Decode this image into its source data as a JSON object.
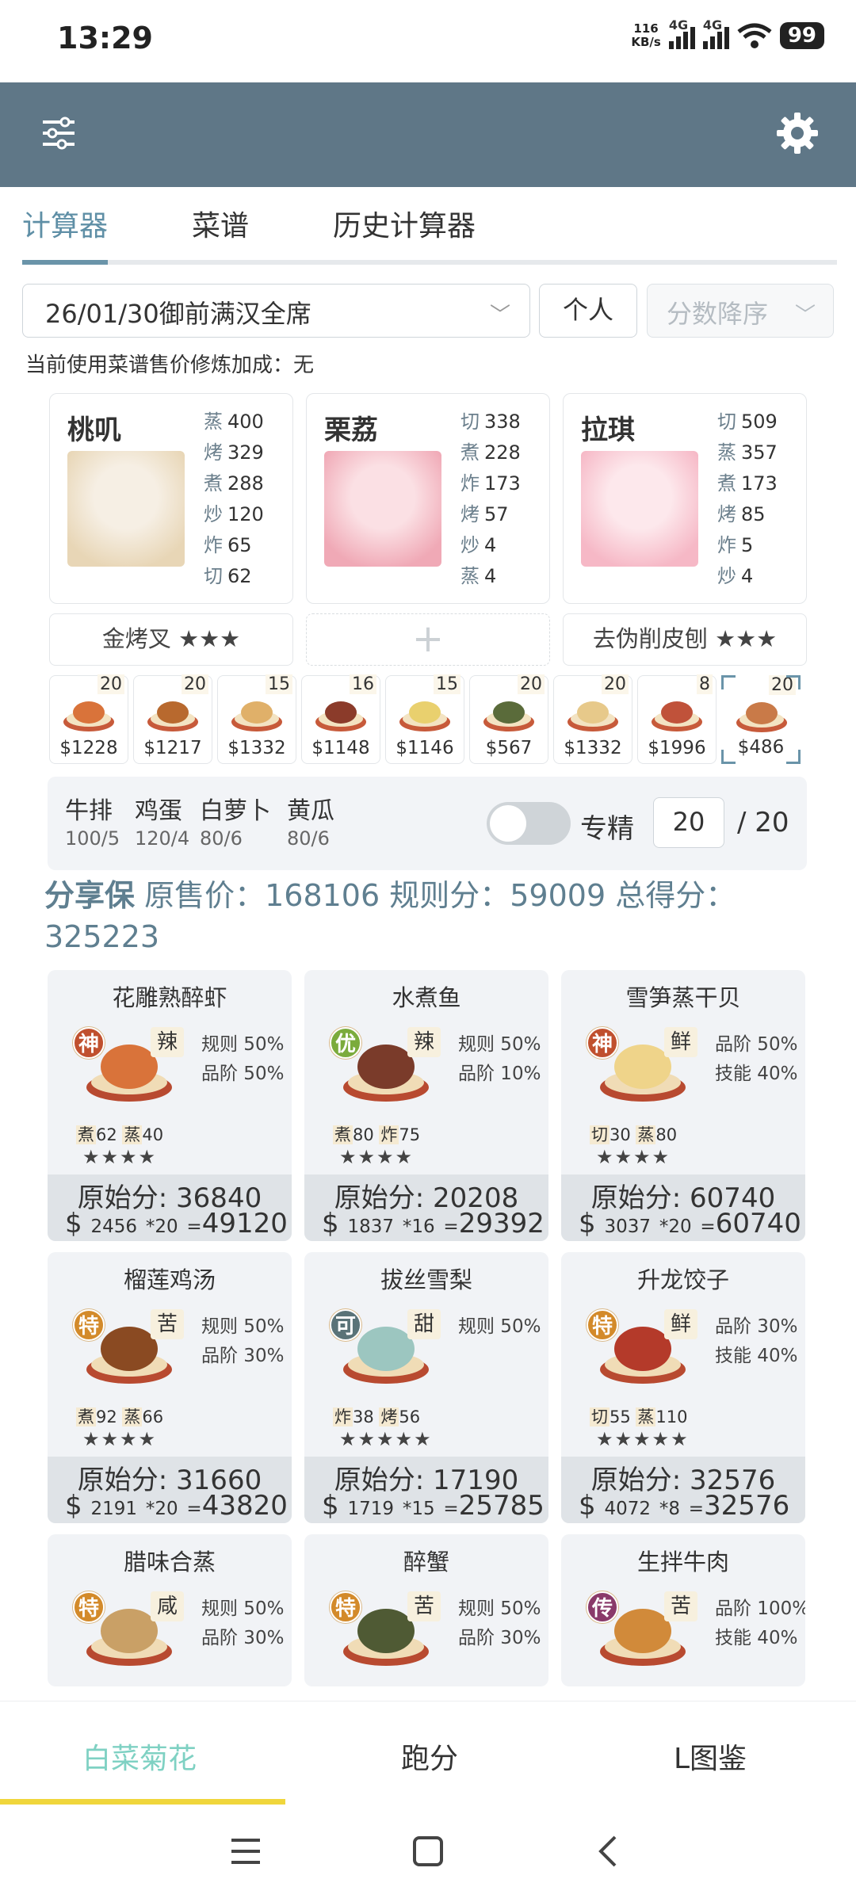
{
  "status": {
    "time": "13:29",
    "speed": "116",
    "speed_unit": "KB/s",
    "net1": "4G",
    "net2": "4G",
    "battery": "99"
  },
  "tabs": [
    "计算器",
    "菜谱",
    "历史计算器"
  ],
  "filters": {
    "rule": "26/01/30御前满汉全席",
    "mode": "个人",
    "sort": "分数降序"
  },
  "bonus_text": "当前使用菜谱售价修炼加成：无",
  "chefs": [
    {
      "name": "桃叽",
      "skills": [
        [
          "蒸",
          "400"
        ],
        [
          "烤",
          "329"
        ],
        [
          "煮",
          "288"
        ],
        [
          "炒",
          "120"
        ],
        [
          "炸",
          "65"
        ],
        [
          "切",
          "62"
        ]
      ],
      "equip": "金烤叉 ★★★"
    },
    {
      "name": "栗荔",
      "skills": [
        [
          "切",
          "338"
        ],
        [
          "煮",
          "228"
        ],
        [
          "炸",
          "173"
        ],
        [
          "烤",
          "57"
        ],
        [
          "炒",
          "4"
        ],
        [
          "蒸",
          "4"
        ]
      ],
      "equip": "+"
    },
    {
      "name": "拉琪",
      "skills": [
        [
          "切",
          "509"
        ],
        [
          "蒸",
          "357"
        ],
        [
          "煮",
          "173"
        ],
        [
          "烤",
          "85"
        ],
        [
          "炸",
          "5"
        ],
        [
          "炒",
          "4"
        ]
      ],
      "equip": "去伪削皮刨 ★★★"
    }
  ],
  "recipe_slots": [
    {
      "count": "20",
      "price": "$1228"
    },
    {
      "count": "20",
      "price": "$1217"
    },
    {
      "count": "15",
      "price": "$1332"
    },
    {
      "count": "16",
      "price": "$1148"
    },
    {
      "count": "15",
      "price": "$1146"
    },
    {
      "count": "20",
      "price": "$567"
    },
    {
      "count": "20",
      "price": "$1332"
    },
    {
      "count": "8",
      "price": "$1996"
    },
    {
      "count": "20",
      "price": "$486"
    }
  ],
  "ingredients": [
    {
      "name": "牛排",
      "qty": "100/5"
    },
    {
      "name": "鸡蛋",
      "qty": "120/4"
    },
    {
      "name": "白萝卜",
      "qty": "80/6"
    },
    {
      "name": "黄瓜",
      "qty": "80/6"
    }
  ],
  "specialize": {
    "label": "专精",
    "value": "20",
    "max": "/ 20"
  },
  "summary": {
    "label": "分享保",
    "text": " 原售价：168106 规则分：59009 总得分：325223"
  },
  "cards": [
    {
      "title": "花雕熟醉虾",
      "grade": "神",
      "gcolor": "#c0502e",
      "flavor": "辣",
      "buffs": [
        "规则 50%",
        "品阶 50%"
      ],
      "skills": [
        [
          "煮",
          "62"
        ],
        [
          "蒸",
          "40"
        ]
      ],
      "stars": "★★★★",
      "raw": "原始分: 36840",
      "unit": "2456",
      "mult": "*20",
      "total": "49120"
    },
    {
      "title": "水煮鱼",
      "grade": "优",
      "gcolor": "#7bab3c",
      "flavor": "辣",
      "buffs": [
        "规则 50%",
        "品阶 10%"
      ],
      "skills": [
        [
          "煮",
          "80"
        ],
        [
          "炸",
          "75"
        ]
      ],
      "stars": "★★★★",
      "raw": "原始分: 20208",
      "unit": "1837",
      "mult": "*16",
      "total": "29392"
    },
    {
      "title": "雪笋蒸干贝",
      "grade": "神",
      "gcolor": "#c0502e",
      "flavor": "鲜",
      "buffs": [
        "品阶 50%",
        "技能 40%"
      ],
      "skills": [
        [
          "切",
          "30"
        ],
        [
          "蒸",
          "80"
        ]
      ],
      "stars": "★★★★",
      "raw": "原始分: 60740",
      "unit": "3037",
      "mult": "*20",
      "total": "60740"
    },
    {
      "title": "榴莲鸡汤",
      "grade": "特",
      "gcolor": "#d38a2a",
      "flavor": "苦",
      "buffs": [
        "规则 50%",
        "品阶 30%"
      ],
      "skills": [
        [
          "煮",
          "92"
        ],
        [
          "蒸",
          "66"
        ]
      ],
      "stars": "★★★★",
      "raw": "原始分: 31660",
      "unit": "2191",
      "mult": "*20",
      "total": "43820"
    },
    {
      "title": "拔丝雪梨",
      "grade": "可",
      "gcolor": "#5a7378",
      "flavor": "甜",
      "buffs": [
        "规则 50%"
      ],
      "skills": [
        [
          "炸",
          "38"
        ],
        [
          "烤",
          "56"
        ]
      ],
      "stars": "★★★★★",
      "raw": "原始分: 17190",
      "unit": "1719",
      "mult": "*15",
      "total": "25785"
    },
    {
      "title": "升龙饺子",
      "grade": "特",
      "gcolor": "#d38a2a",
      "flavor": "鲜",
      "buffs": [
        "品阶 30%",
        "技能 40%"
      ],
      "skills": [
        [
          "切",
          "55"
        ],
        [
          "蒸",
          "110"
        ]
      ],
      "stars": "★★★★★",
      "raw": "原始分: 32576",
      "unit": "4072",
      "mult": "*8",
      "total": "32576"
    },
    {
      "title": "腊味合蒸",
      "grade": "特",
      "gcolor": "#d38a2a",
      "flavor": "咸",
      "buffs": [
        "规则 50%",
        "品阶 30%"
      ]
    },
    {
      "title": "醉蟹",
      "grade": "特",
      "gcolor": "#d38a2a",
      "flavor": "苦",
      "buffs": [
        "规则 50%",
        "品阶 30%"
      ]
    },
    {
      "title": "生拌牛肉",
      "grade": "传",
      "gcolor": "#8a3a6a",
      "flavor": "苦",
      "buffs": [
        "品阶 100%",
        "技能 40%"
      ]
    }
  ],
  "bottom_nav": [
    "白菜菊花",
    "跑分",
    "L图鉴"
  ]
}
